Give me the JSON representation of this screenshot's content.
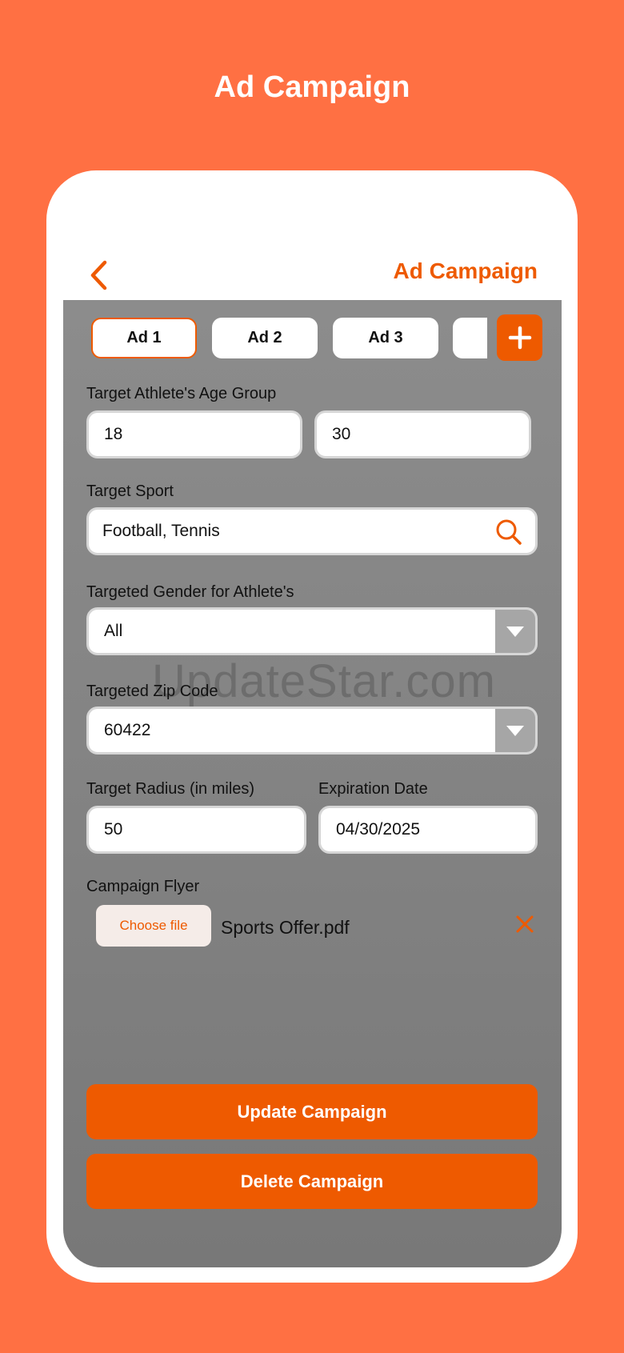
{
  "page_title": "Ad Campaign",
  "header": {
    "title": "Ad Campaign",
    "back_icon": "chevron-left-icon"
  },
  "tabs": [
    {
      "label": "Ad 1",
      "active": true
    },
    {
      "label": "Ad 2",
      "active": false
    },
    {
      "label": "Ad 3",
      "active": false
    }
  ],
  "add_button_icon": "plus-icon",
  "age_group": {
    "label": "Target Athlete's Age Group",
    "min": "18",
    "max": "30"
  },
  "sport": {
    "label": "Target Sport",
    "value": "Football, Tennis",
    "icon": "search-icon"
  },
  "gender": {
    "label": "Targeted Gender for Athlete's",
    "value": "All"
  },
  "zip": {
    "label": "Targeted Zip Code",
    "value": "60422"
  },
  "radius": {
    "label": "Target Radius (in miles)",
    "value": "50"
  },
  "expiration": {
    "label": "Expiration Date",
    "value": "04/30/2025"
  },
  "flyer": {
    "label": "Campaign Flyer",
    "choose_label": "Choose file",
    "file_name": "Sports Offer.pdf",
    "remove_icon": "close-icon"
  },
  "watermark": "UpdateStar.com",
  "actions": {
    "update_label": "Update Campaign",
    "delete_label": "Delete Campaign"
  },
  "colors": {
    "background": "#ff7043",
    "accent": "#ee5a00",
    "screen": "#838383"
  }
}
